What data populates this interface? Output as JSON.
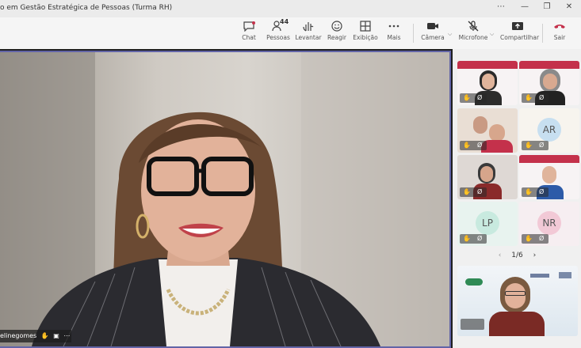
{
  "window": {
    "title": "o em Gestão Estratégica de Pessoas (Turma RH)",
    "controls": [
      "⋯",
      "—",
      "❐",
      "✕"
    ]
  },
  "toolbar": {
    "chat": "Chat",
    "people": "Pessoas",
    "people_count": "44",
    "raise": "Levantar",
    "react": "Reagir",
    "view": "Exibição",
    "more": "Mais",
    "camera": "Câmera",
    "mic": "Microfone",
    "share": "Compartilhar",
    "leave": "Sair",
    "leave_color": "#c4314b"
  },
  "main_video": {
    "speaker_name": "elinegomes"
  },
  "participants": {
    "tiles": [
      {
        "type": "video"
      },
      {
        "type": "video"
      },
      {
        "type": "video"
      },
      {
        "type": "avatar",
        "initials": "AR",
        "color": "#c7dff0"
      },
      {
        "type": "video"
      },
      {
        "type": "video"
      },
      {
        "type": "avatar",
        "initials": "LP",
        "color": "#c8eadf"
      },
      {
        "type": "avatar",
        "initials": "NR",
        "color": "#f2c9d6"
      }
    ],
    "page_indicator": "1/6"
  },
  "colors": {
    "accent": "#6264a7"
  }
}
